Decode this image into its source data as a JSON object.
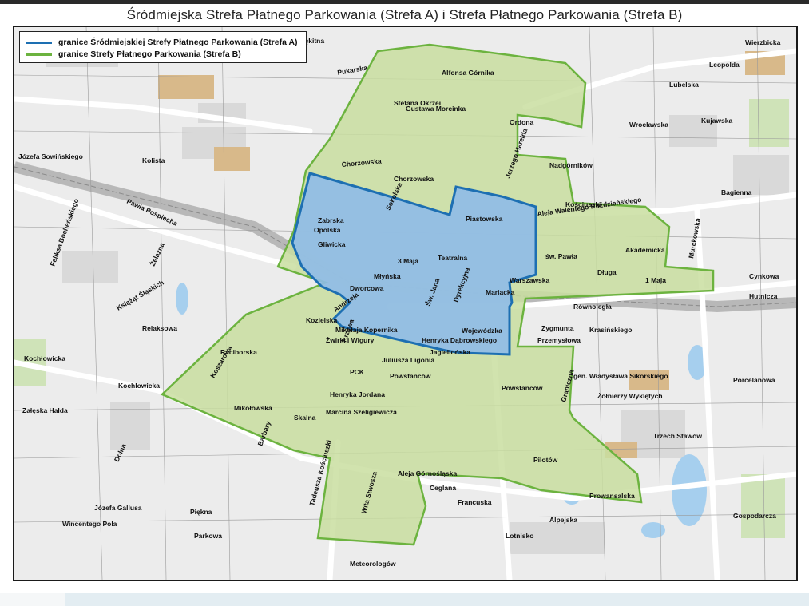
{
  "document": {
    "title": "Śródmiejska Strefa Płatnego Parkowania (Strefa A) i Strefa Płatnego Parkowania (Strefa B)"
  },
  "legend": {
    "items": [
      {
        "label": "granice Śródmiejskiej Strefy Płatnego Parkowania (Strefa A)",
        "color": "#1d6fb2"
      },
      {
        "label": "granice Strefy Płatnego Parkowania (Strefa B)",
        "color": "#6cb33f"
      }
    ]
  },
  "zones": {
    "zone_a": {
      "fill": "#8fbbe8",
      "stroke": "#1d6fb2"
    },
    "zone_b": {
      "fill": "#c9dea0",
      "stroke": "#6cb33f"
    }
  },
  "map_labels": {
    "alfonsa_gornika": "Alfonsa Górnika",
    "blekitna": "Błękitna",
    "wierzbicka": "Wierzbicka",
    "pukarska": "Pukarska",
    "leopolda": "Leopolda",
    "stefana_okrzei": "Stefana Okrzei",
    "gustawa_morcinka": "Gustawa Morcinka",
    "ordona": "Ordona",
    "chorzowska_w": "Chorzowska",
    "chorzowska_c": "Chorzowska",
    "nadgornikow": "Nadgórników",
    "kosciuszki_top": "Kościuszki",
    "jerzego_hareldy": "Jerzego Harelda",
    "bagienna": "Bagienna",
    "walentego": "Aleja Walentego Roździeńskiego",
    "wroclawska": "Wrocławska",
    "kujawska": "Kujawska",
    "lubelska": "Lubelska",
    "zabrska": "Zabrska",
    "opolska": "Opolska",
    "gliwicka": "Gliwicka",
    "sokolska": "Sokolska",
    "piastowska": "Piastowska",
    "teatralna": "Teatralna",
    "tmaja": "3 Maja",
    "mlynska": "Młyńska",
    "dworcowa": "Dworcowa",
    "sw_jana": "Św. Jana",
    "dyrekcyjna": "Dyrekcyjna",
    "warszawska": "Warszawska",
    "mariacka": "Mariacka",
    "sw_pawla": "św. Pawła",
    "akademicka": "Akademicka",
    "dluga": "Długa",
    "one_maja": "1 Maja",
    "cynkowa": "Cynkowa",
    "hutnicza": "Hutnicza",
    "rownolegla": "Równoległa",
    "krasinskiego": "Krasińskiego",
    "przemyslowa": "Przemysłowa",
    "zygmunta": "Zygmunta",
    "andrzeja": "Andrzeja",
    "wojewodzka": "Wojewódzka",
    "henryka_dabrowskiego": "Henryka Dąbrowskiego",
    "jagiellonska": "Jagiellońska",
    "mikolaja_kopernika": "Mikołaja Kopernika",
    "krzywa": "Krzywa",
    "kozielska": "Kozielska",
    "raciborska": "Raciborska",
    "zwirki_wigury": "Żwirki i Wigury",
    "juliusza_ligonia": "Juliusza Ligonia",
    "pck": "PCK",
    "powstancow": "Powstańców",
    "kochlowicka": "Kochłowicka",
    "koszarowa": "Koszarowa",
    "mikolowska": "Mikołowska",
    "henryka_jordana": "Henryka Jordana",
    "skalna": "Skalna",
    "marcina_szeligiewicza": "Marcina Szeligiewicza",
    "barbary": "Barbary",
    "graniczna": "Graniczna",
    "wl_sikorskiego": "gen. Władysława Sikorskiego",
    "zolnierzy_wykletych": "Żołnierzy Wyklętych",
    "porcelanowa": "Porcelanowa",
    "trzech_stawow": "Trzech Stawów",
    "pilotow": "Pilotów",
    "gornoslaska": "Aleja Górnośląska",
    "prowansalska": "Prowansalska",
    "francuska": "Francuska",
    "ceglana": "Ceglana",
    "lotnisko": "Lotnisko",
    "alpejska": "Alpejska",
    "murckowska": "Murckowska",
    "tadeusza_kosciuszki": "Tadeusza Kościuszki",
    "wita_stwosza": "Wita Stwosza",
    "meteorologow": "Meteorologów",
    "zalejska": "Załęska Hałda",
    "jozefa_gallusa": "Józefa Gallusa",
    "piekna": "Piękna",
    "wincentego_pola": "Wincentego Pola",
    "parkowa": "Parkowa",
    "dolna": "Dolna",
    "pawla_pospiecha": "Pawła Pośpiecha",
    "jozefa_sowinskiego": "Józefa Sowińskiego",
    "kolista": "Kolista",
    "zelazna": "Żelazna",
    "feliksa_bochenskiego": "Feliksa Bocheńskiego",
    "relaksowa": "Relaksowa",
    "ksiazat_slaskich": "Książąt Śląskich",
    "gospodarcza": "Gospodarcza"
  }
}
